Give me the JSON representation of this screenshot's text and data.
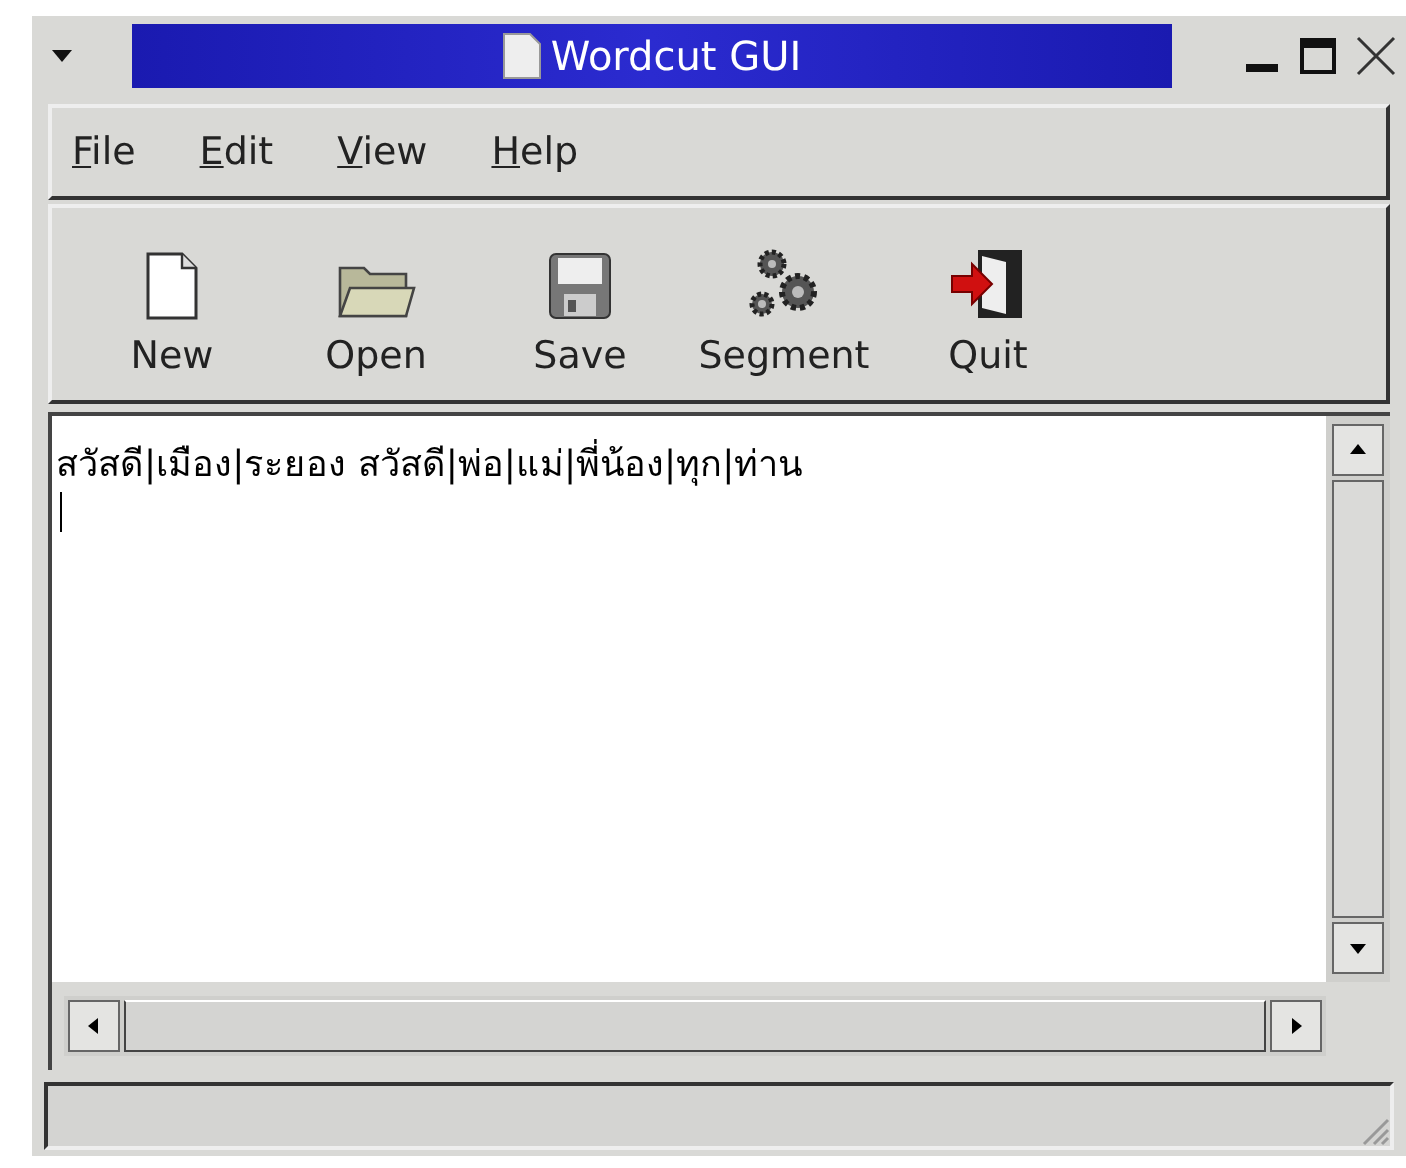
{
  "window": {
    "title": "Wordcut GUI"
  },
  "menu": [
    "File",
    "Edit",
    "View",
    "Help"
  ],
  "toolbar": [
    {
      "label": "New",
      "kind": "new"
    },
    {
      "label": "Open",
      "kind": "open"
    },
    {
      "label": "Save",
      "kind": "save"
    },
    {
      "label": "Segment",
      "kind": "segment"
    },
    {
      "label": "Quit",
      "kind": "quit"
    }
  ],
  "editor": {
    "text": "สวัสดี|เมือง|ระยอง สวัสดี|พ่อ|แม่|พี่น้อง|ทุก|ท่าน"
  }
}
